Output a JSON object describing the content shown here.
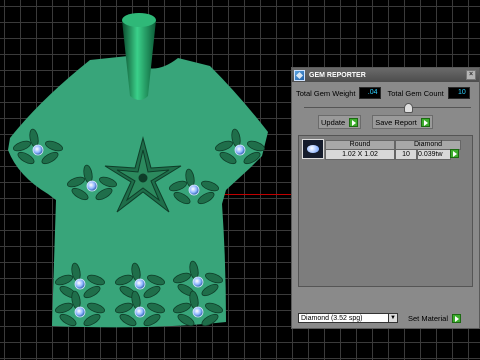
{
  "panel": {
    "title": "GEM REPORTER",
    "close_glyph": "×",
    "icon": "gem-reporter-app-icon",
    "stats": {
      "weight_label": "Total Gem Weight",
      "weight_value": ".04",
      "count_label": "Total Gem Count",
      "count_value": "10"
    },
    "buttons": {
      "update": "Update",
      "save_report": "Save Report",
      "set_material": "Set Material"
    },
    "slider_level": 0.6,
    "table": {
      "headers": [
        "Round",
        "Diamond"
      ],
      "row": {
        "size": "1.02 X 1.02",
        "count": "10",
        "weight": "0.039tw"
      }
    },
    "material_select": {
      "value": "Diamond     (3.52 spg)"
    }
  },
  "colors": {
    "grid_background": "#000000",
    "grid_lines": "#3a3a3a",
    "shirt": "#38a57a",
    "ornament": "#1f6e4a",
    "gem": "#8fb6ff",
    "panel": "#8a8a8a",
    "value_text": "#2fd2ff",
    "play_button": "#3cad2c"
  }
}
